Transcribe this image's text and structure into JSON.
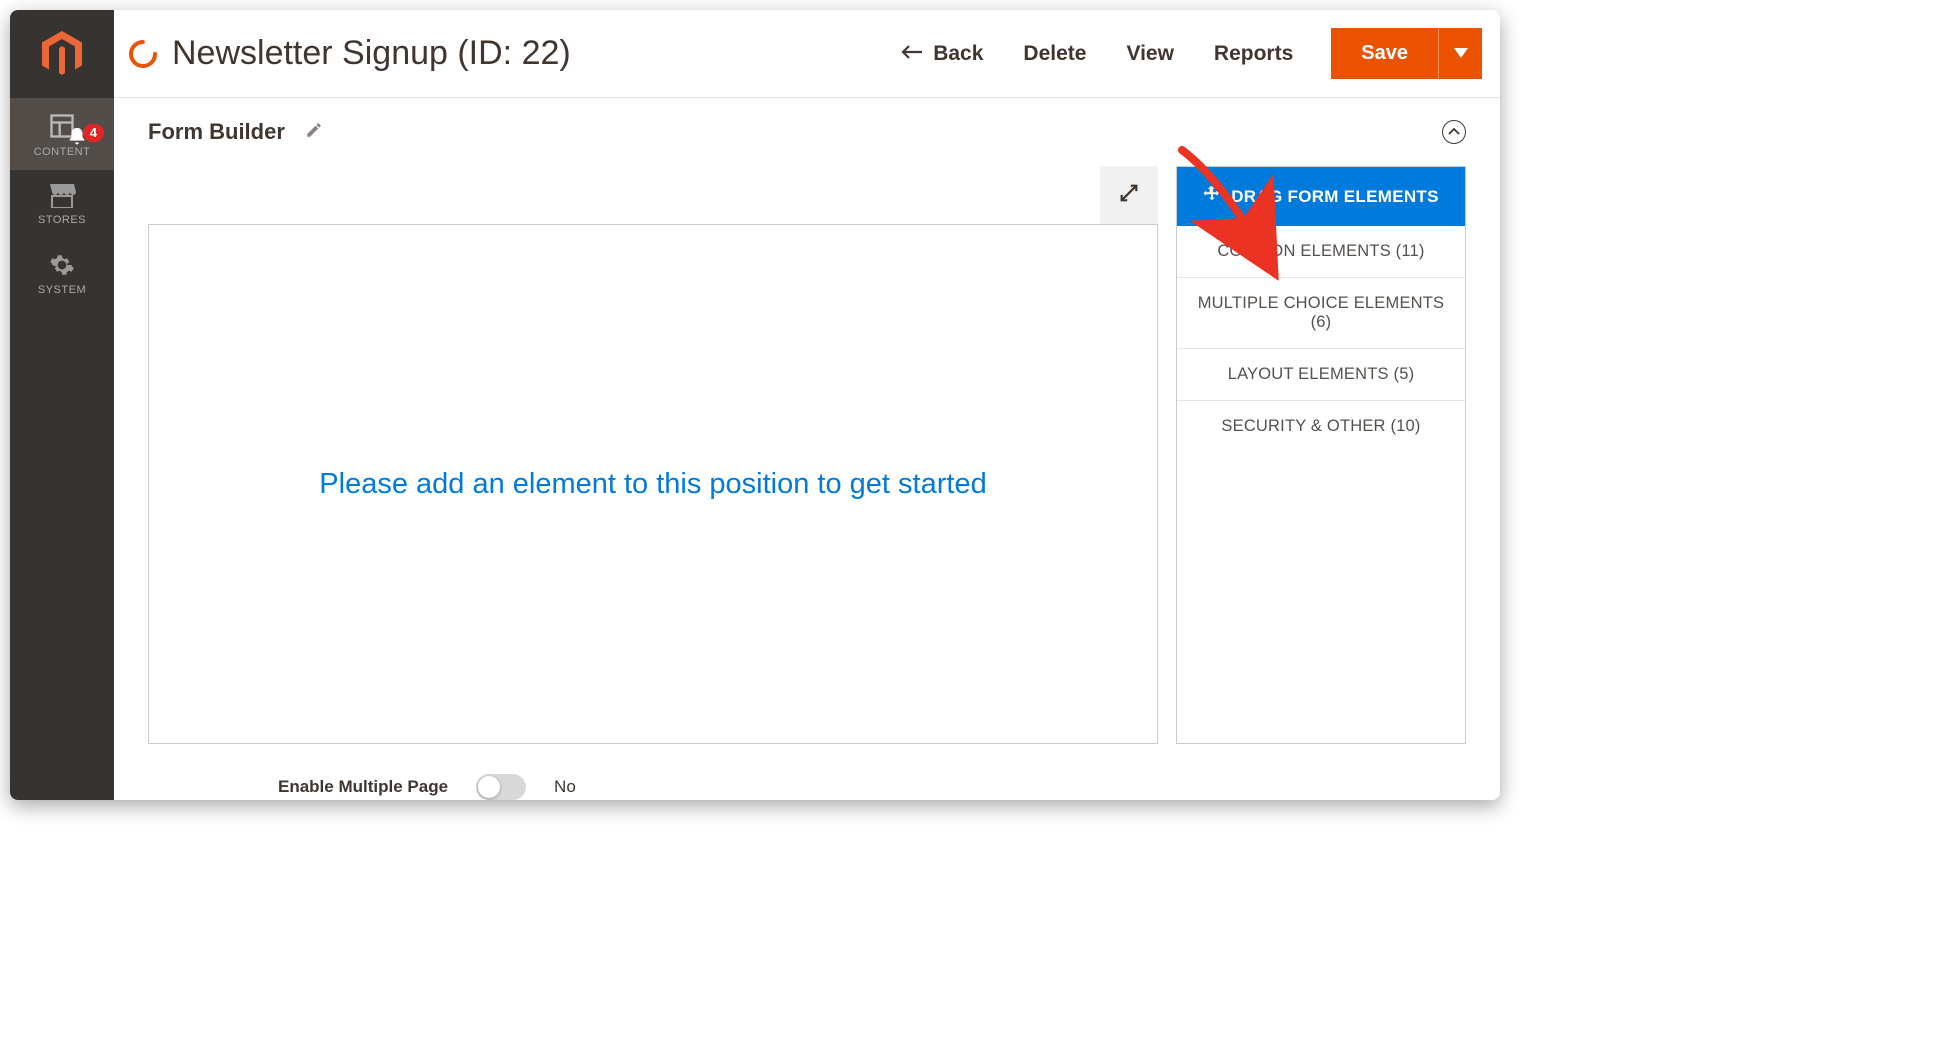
{
  "sidebar": {
    "items": [
      {
        "label": "CONTENT",
        "badge": "4"
      },
      {
        "label": "STORES"
      },
      {
        "label": "SYSTEM"
      }
    ]
  },
  "header": {
    "title": "Newsletter Signup (ID: 22)",
    "actions": {
      "back": "Back",
      "delete": "Delete",
      "view": "View",
      "reports": "Reports",
      "save": "Save"
    }
  },
  "section": {
    "title": "Form Builder"
  },
  "canvas": {
    "placeholder": "Please add an element to this position to get started"
  },
  "elements_panel": {
    "header": "DRAG FORM ELEMENTS",
    "categories": [
      "COMMON ELEMENTS (11)",
      "MULTIPLE CHOICE ELEMENTS (6)",
      "LAYOUT ELEMENTS (5)",
      "SECURITY & OTHER (10)"
    ]
  },
  "footer": {
    "multi_page_label": "Enable Multiple Page",
    "multi_page_value": "No"
  },
  "colors": {
    "accent": "#eb5202",
    "link": "#007bdb",
    "sidebar_bg": "#373330"
  }
}
